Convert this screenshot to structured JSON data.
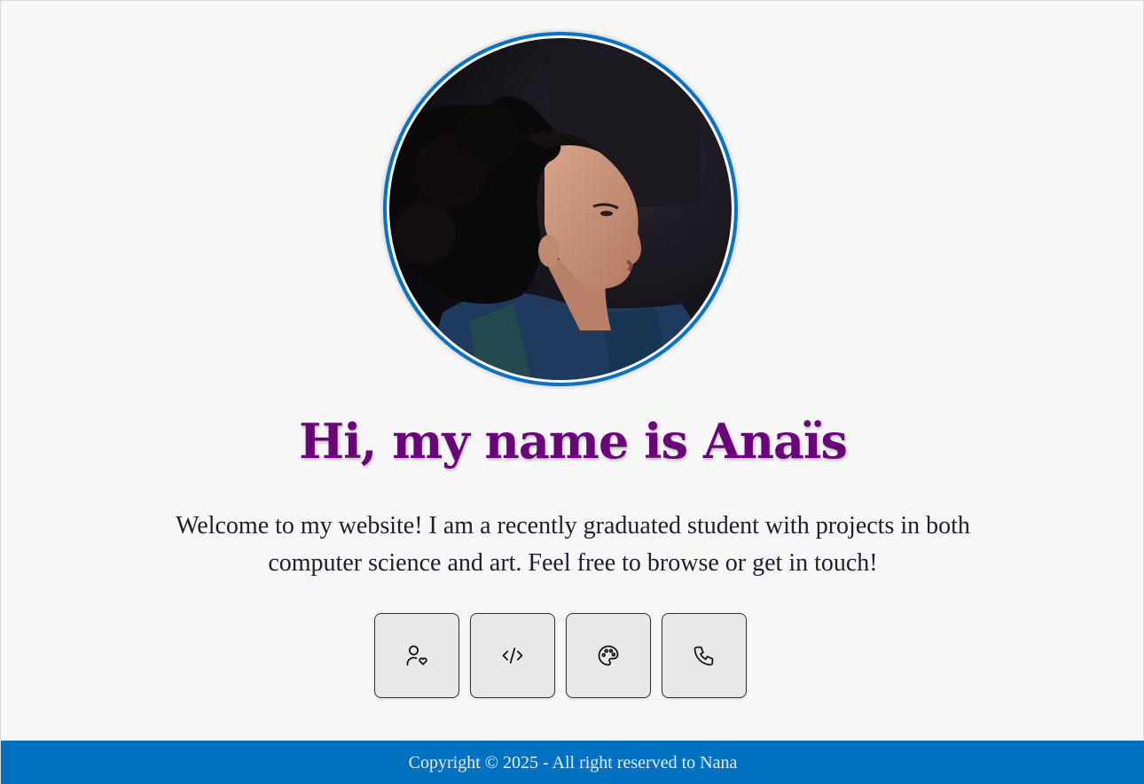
{
  "profile": {
    "photo_alt": "Portrait photo",
    "ring_color": "#0a72c0"
  },
  "hero": {
    "title": "Hi, my name is Anaïs",
    "title_color": "#6a0479",
    "intro": "Welcome to my website! I am a recently graduated student with projects in both computer science and art. Feel free to browse or get in touch!"
  },
  "nav_buttons": [
    {
      "icon": "user-heart-icon"
    },
    {
      "icon": "code-icon"
    },
    {
      "icon": "palette-icon"
    },
    {
      "icon": "phone-icon"
    }
  ],
  "footer": {
    "text": "Copyright © 2025 - All right reserved to Nana",
    "background": "#0071c1"
  }
}
